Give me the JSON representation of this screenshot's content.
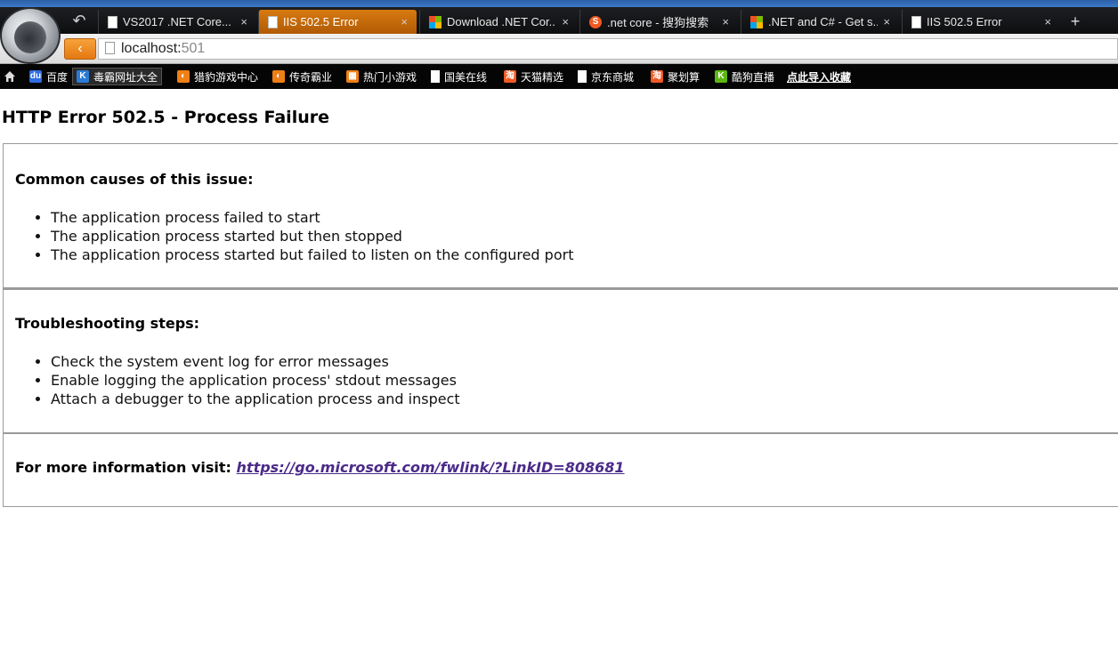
{
  "browser": {
    "tabs": [
      {
        "label": "VS2017 .NET Core...",
        "icon": "page-icon",
        "active": false
      },
      {
        "label": "IIS 502.5 Error",
        "icon": "page-icon",
        "active": true
      },
      {
        "label": "Download .NET Cor...",
        "icon": "microsoft-icon",
        "active": false
      },
      {
        "label": ".net core - 搜狗搜索",
        "icon": "sogou-icon",
        "active": false
      },
      {
        "label": ".NET and C# - Get s...",
        "icon": "microsoft-icon",
        "active": false
      },
      {
        "label": "IIS 502.5 Error",
        "icon": "page-icon",
        "active": false
      }
    ],
    "close_glyph": "×",
    "new_tab_glyph": "+",
    "back_glyph": "‹",
    "url": {
      "host": "localhost:",
      "port": "501"
    },
    "bookmarks": [
      {
        "label": "百度",
        "icon_text": "du",
        "color": "#2f6de1"
      },
      {
        "label": "毒霸网址大全",
        "icon_text": "K",
        "color": "#2b7bd6"
      },
      {
        "label": "猎豹游戏中心",
        "icon_text": "◐",
        "color": "#f07f16"
      },
      {
        "label": "传奇霸业",
        "icon_text": "◐",
        "color": "#f07f16"
      },
      {
        "label": "热门小游戏",
        "icon_text": "▦",
        "color": "#f07f16"
      },
      {
        "label": "国美在线",
        "icon_text": "",
        "color": "#ffffff"
      },
      {
        "label": "天猫精选",
        "icon_text": "淘",
        "color": "#f05a22"
      },
      {
        "label": "京东商城",
        "icon_text": "",
        "color": "#ffffff"
      },
      {
        "label": "聚划算",
        "icon_text": "淘",
        "color": "#f05a22"
      },
      {
        "label": "酷狗直播",
        "icon_text": "K",
        "color": "#5cb811"
      },
      {
        "label": "点此导入收藏",
        "icon_text": "",
        "color": ""
      }
    ]
  },
  "page": {
    "title": "HTTP Error 502.5 - Process Failure",
    "causes": {
      "heading": "Common causes of this issue:",
      "items": [
        "The application process failed to start",
        "The application process started but then stopped",
        "The application process started but failed to listen on the configured port"
      ]
    },
    "troubleshooting": {
      "heading": "Troubleshooting steps:",
      "items": [
        "Check the system event log for error messages",
        "Enable logging the application process' stdout messages",
        "Attach a debugger to the application process and inspect"
      ]
    },
    "more_info": {
      "label": "For more information visit: ",
      "link": "https://go.microsoft.com/fwlink/?LinkID=808681"
    }
  }
}
